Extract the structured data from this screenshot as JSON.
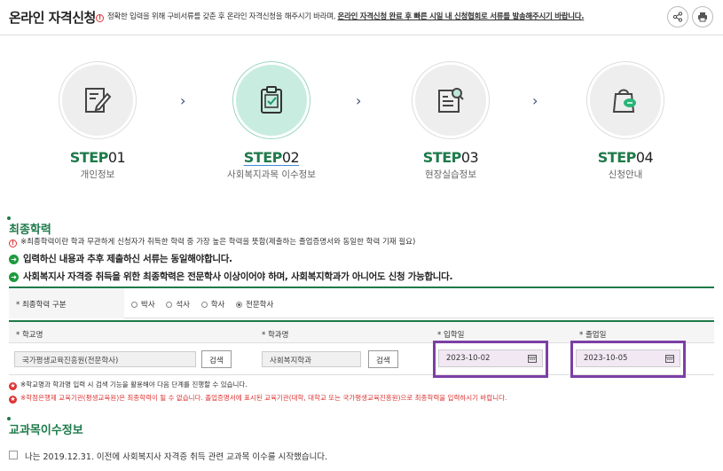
{
  "header": {
    "title": "온라인 자격신청",
    "notice_plain": "정확한 입력을 위해 구비서류를 갖춘 후 온라인 자격신청을 해주시기 바라며, ",
    "notice_bold": "온라인 자격신청 완료 후 빠른 시일 내 신청협회로 서류를 발송해주시기 바랍니다.",
    "share_icon": "share-icon",
    "print_icon": "print-icon"
  },
  "steps": [
    {
      "prefix": "STEP",
      "num": "01",
      "label": "개인정보",
      "icon": "edit-document-icon",
      "active": false
    },
    {
      "prefix": "STEP",
      "num": "02",
      "label": "사회복지과목 이수정보",
      "icon": "clipboard-check-icon",
      "active": true
    },
    {
      "prefix": "STEP",
      "num": "03",
      "label": "현장실습정보",
      "icon": "document-search-icon",
      "active": false
    },
    {
      "prefix": "STEP",
      "num": "04",
      "label": "신청안내",
      "icon": "shopping-bag-chat-icon",
      "active": false
    }
  ],
  "education": {
    "title": "최종학력",
    "note": "※최종학력이란 학과 무관하게 신청자가 취득한 학력 중 가장 높은 학력을 뜻함(제출하는 졸업증명서와 동일한 학력 기재 필요)",
    "line1": "입력하신 내용과 추후 제출하신 서류는 동일해야합니다.",
    "line2": "사회복지사 자격증 취득을 위한 최종학력은 전문학사 이상이어야 하며, 사회복지학과가 아니어도 신청 가능합니다.",
    "degree_label": "* 최종학력 구분",
    "degree_options": [
      "박사",
      "석사",
      "학사",
      "전문학사"
    ],
    "degree_selected": "전문학사",
    "school_label": "* 학교명",
    "dept_label": "* 학과명",
    "admit_label": "* 입학일",
    "grad_label": "* 졸업일",
    "school_value": "국가평생교육진흥원(전문학사)",
    "dept_value": "사회복지학과",
    "search_label": "검색",
    "admit_date": "2023-10-02",
    "grad_date": "2023-10-05",
    "warn1": "※학교명과 학과명 입력 시 검색 기능을 활용해야 다음 단계를 진행할 수 있습니다.",
    "warn2": "※학점은행제 교육기관(평생교육원)은 최종학력이 될 수 없습니다. 졸업증명서에 표시된 교육기관(대학, 대학교 또는 국가평생교육진흥원)으로 최종학력을 입력하시기 바랍니다."
  },
  "course": {
    "title": "교과목이수정보",
    "checkbox_label": "나는 2019.12.31. 이전에 사회복지사 자격증 취득 관련 교과목 이수를 시작했습니다."
  },
  "colors": {
    "accent": "#1e7a4a",
    "highlight": "#7b3fa5",
    "warning": "#dd3333"
  }
}
